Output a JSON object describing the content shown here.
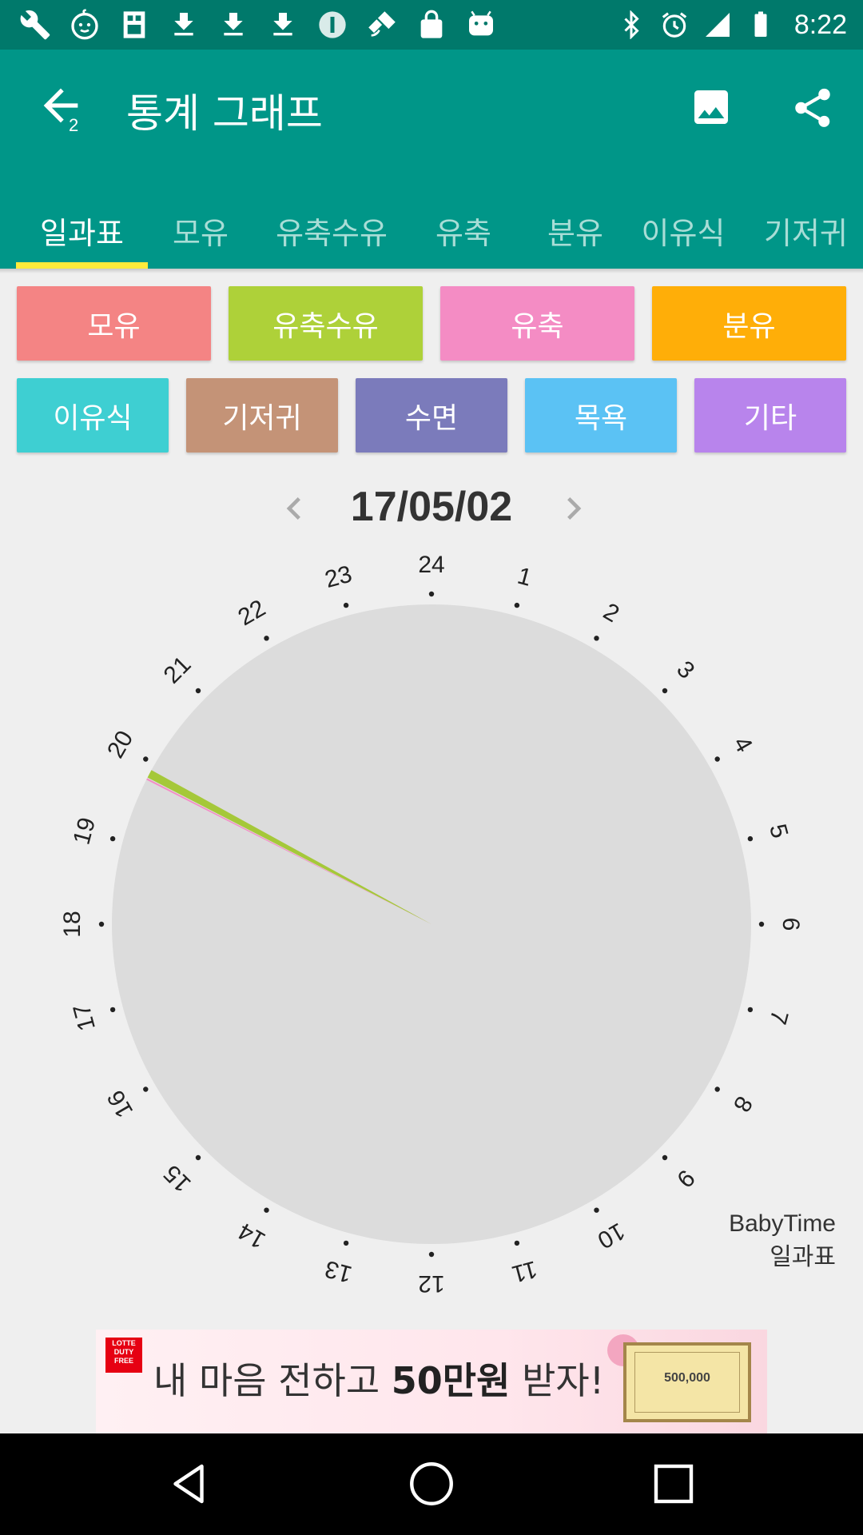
{
  "status_bar": {
    "time": "8:22",
    "left_icons": [
      "wrench-icon",
      "baby-face-icon",
      "flash-icon",
      "download-icon",
      "download-icon",
      "download-icon",
      "info-circle-icon",
      "fake-gps-icon",
      "lock-icon",
      "android-icon"
    ],
    "right_icons": [
      "bluetooth-icon",
      "alarm-icon",
      "signal-icon",
      "battery-icon"
    ]
  },
  "app_bar": {
    "title": "통계 그래프",
    "back_badge": "2",
    "background": "#009688"
  },
  "tabs": [
    "일과표",
    "모유",
    "유축수유",
    "유축",
    "분유",
    "이유식",
    "기저귀"
  ],
  "active_tab": 0,
  "categories_row1": [
    {
      "label": "모유",
      "color": "#f48484"
    },
    {
      "label": "유축수유",
      "color": "#aed139"
    },
    {
      "label": "유축",
      "color": "#f48cc4"
    },
    {
      "label": "분유",
      "color": "#ffae08"
    }
  ],
  "categories_row2": [
    {
      "label": "이유식",
      "color": "#3ecfd2"
    },
    {
      "label": "기저귀",
      "color": "#c49377"
    },
    {
      "label": "수면",
      "color": "#7b7bbb"
    },
    {
      "label": "목욕",
      "color": "#5bc2f4"
    },
    {
      "label": "기타",
      "color": "#b884ec"
    }
  ],
  "date": "17/05/02",
  "clock": {
    "hour_labels": [
      "24",
      "1",
      "2",
      "3",
      "4",
      "5",
      "6",
      "7",
      "8",
      "9",
      "10",
      "11",
      "12",
      "13",
      "14",
      "15",
      "16",
      "17",
      "18",
      "19",
      "20",
      "21",
      "22",
      "23"
    ],
    "face_color": "#dcdcdc",
    "events": [
      {
        "category": "유축수유",
        "start_hour": 19.82,
        "end_hour": 19.92,
        "color": "#a5c839"
      },
      {
        "category": "유축",
        "start_hour": 19.79,
        "end_hour": 19.81,
        "color": "#f48cc4"
      }
    ]
  },
  "watermark": {
    "line1": "BabyTime",
    "line2": "일과표"
  },
  "ad": {
    "brand_line1": "LOTTE",
    "brand_line2": "DUTY",
    "brand_line3": "FREE",
    "text_before": "내 마음 전하고 ",
    "text_bold": "50만원",
    "text_after": " 받자!",
    "coupon_value": "500,000"
  }
}
